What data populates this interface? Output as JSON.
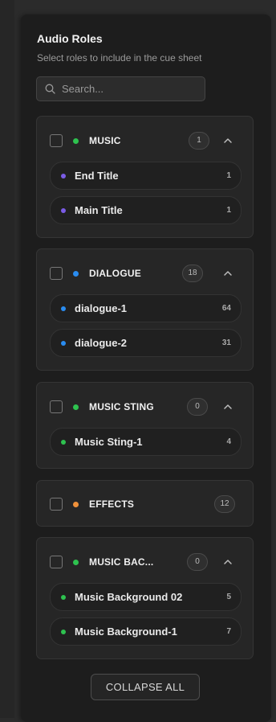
{
  "header": {
    "title": "Audio Roles",
    "subtitle": "Select roles to include in the cue sheet"
  },
  "search": {
    "placeholder": "Search..."
  },
  "colors": {
    "green": "#2ec24f",
    "purple": "#7b5ce6",
    "blue": "#2a8cf0",
    "orange": "#f0913a"
  },
  "groups": [
    {
      "name": "MUSIC",
      "count": "1",
      "dot_color": "#2ec24f",
      "expanded": true,
      "items": [
        {
          "name": "End Title",
          "count": "1",
          "dot_color": "#7b5ce6"
        },
        {
          "name": "Main Title",
          "count": "1",
          "dot_color": "#7b5ce6"
        }
      ]
    },
    {
      "name": "DIALOGUE",
      "count": "18",
      "dot_color": "#2a8cf0",
      "expanded": true,
      "items": [
        {
          "name": "dialogue-1",
          "count": "64",
          "dot_color": "#2a8cf0"
        },
        {
          "name": "dialogue-2",
          "count": "31",
          "dot_color": "#2a8cf0"
        }
      ]
    },
    {
      "name": "MUSIC STING",
      "count": "0",
      "dot_color": "#2ec24f",
      "expanded": true,
      "items": [
        {
          "name": "Music Sting-1",
          "count": "4",
          "dot_color": "#2ec24f"
        }
      ]
    },
    {
      "name": "EFFECTS",
      "count": "12",
      "dot_color": "#f0913a",
      "expanded": false,
      "items": []
    },
    {
      "name": "MUSIC BAC...",
      "count": "0",
      "dot_color": "#2ec24f",
      "expanded": true,
      "items": [
        {
          "name": "Music Background 02",
          "count": "5",
          "dot_color": "#2ec24f"
        },
        {
          "name": "Music Background-1",
          "count": "7",
          "dot_color": "#2ec24f"
        }
      ]
    }
  ],
  "footer": {
    "collapse_label": "COLLAPSE ALL"
  },
  "icons": {
    "search": "search-icon",
    "chevron": "chevron-up-icon"
  }
}
